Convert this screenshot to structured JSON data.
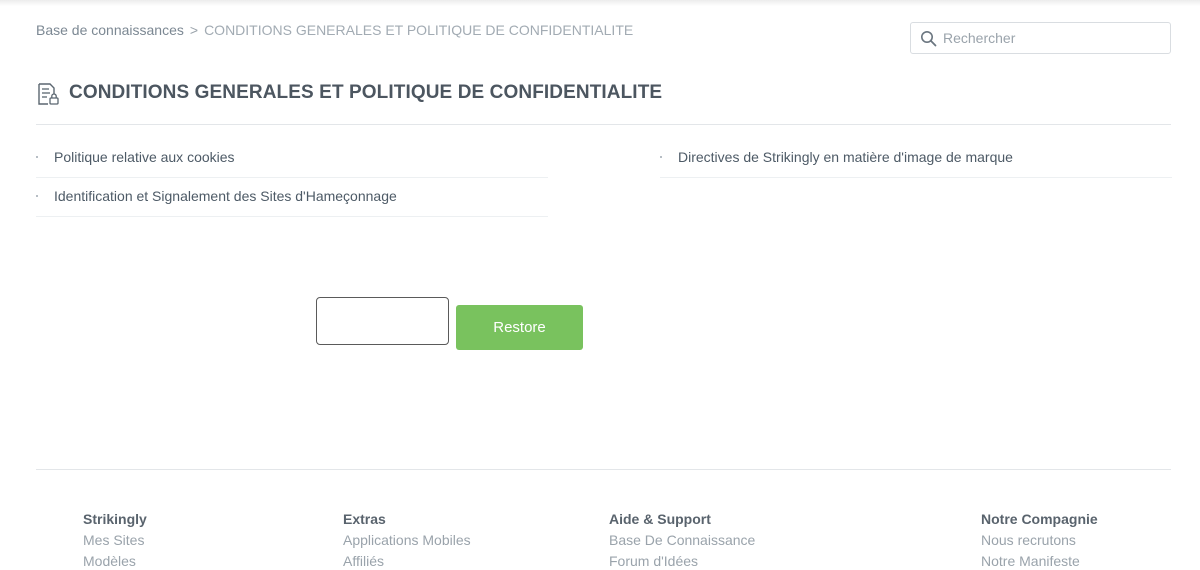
{
  "breadcrumb": {
    "root": "Base de connaissances",
    "separator": ">",
    "current": "CONDITIONS GENERALES ET POLITIQUE DE CONFIDENTIALITE"
  },
  "search": {
    "placeholder": "Rechercher",
    "value": ""
  },
  "page": {
    "title": "CONDITIONS GENERALES ET POLITIQUE DE CONFIDENTIALITE",
    "icon": "document-lock-icon"
  },
  "articles": {
    "left": [
      {
        "label": "Politique relative aux cookies"
      },
      {
        "label": "Identification et Signalement des Sites d'Hameçonnage"
      }
    ],
    "right": [
      {
        "label": "Directives de Strikingly en matière d'image de marque"
      }
    ]
  },
  "restore": {
    "input_value": "",
    "button_label": "Restore"
  },
  "footer": {
    "columns": [
      {
        "title": "Strikingly",
        "links": [
          "Mes Sites",
          "Modèles"
        ]
      },
      {
        "title": "Extras",
        "links": [
          "Applications Mobiles",
          "Affiliés"
        ]
      },
      {
        "title": "Aide & Support",
        "links": [
          "Base De Connaissance",
          "Forum d'Idées"
        ]
      },
      {
        "title": "Notre Compagnie",
        "links": [
          "Nous recrutons",
          "Notre Manifeste"
        ]
      }
    ]
  },
  "colors": {
    "accent_green": "#79c25e",
    "text": "#4d5a66",
    "muted": "#9aa3ab",
    "divider": "#e3e6e9"
  }
}
